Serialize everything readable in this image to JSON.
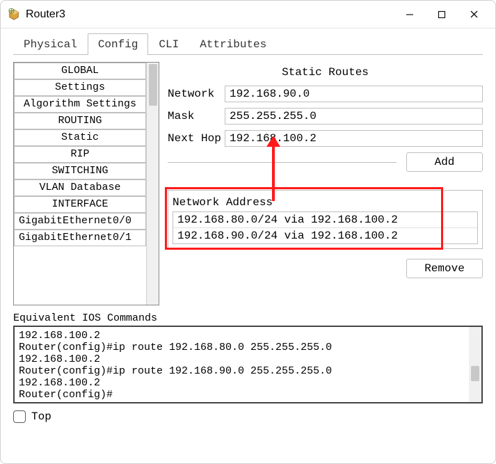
{
  "window": {
    "title": "Router3"
  },
  "tabs": [
    "Physical",
    "Config",
    "CLI",
    "Attributes"
  ],
  "active_tab_index": 1,
  "sidebar": {
    "items": [
      {
        "label": "GLOBAL",
        "align": "center"
      },
      {
        "label": "Settings",
        "align": "center"
      },
      {
        "label": "Algorithm Settings",
        "align": "center"
      },
      {
        "label": "ROUTING",
        "align": "center"
      },
      {
        "label": "Static",
        "align": "center"
      },
      {
        "label": "RIP",
        "align": "center"
      },
      {
        "label": "SWITCHING",
        "align": "center"
      },
      {
        "label": "VLAN Database",
        "align": "center"
      },
      {
        "label": "INTERFACE",
        "align": "center"
      },
      {
        "label": "GigabitEthernet0/0",
        "align": "left"
      },
      {
        "label": "GigabitEthernet0/1",
        "align": "left"
      }
    ]
  },
  "static_routes": {
    "title": "Static Routes",
    "network_label": "Network",
    "mask_label": "Mask",
    "nexthop_label": "Next Hop",
    "network_value": "192.168.90.0",
    "mask_value": "255.255.255.0",
    "nexthop_value": "192.168.100.2",
    "add_label": "Add",
    "list_header": "Network Address",
    "routes": [
      "192.168.80.0/24 via 192.168.100.2",
      "192.168.90.0/24 via 192.168.100.2"
    ],
    "remove_label": "Remove"
  },
  "ios": {
    "label": "Equivalent IOS Commands",
    "text": "192.168.100.2\nRouter(config)#ip route 192.168.80.0 255.255.255.0\n192.168.100.2\nRouter(config)#ip route 192.168.90.0 255.255.255.0\n192.168.100.2\nRouter(config)#"
  },
  "bottom": {
    "top_label": "Top"
  },
  "annotation": {
    "redbox_color": "#ff1a1a",
    "arrow_color": "#ff1a1a"
  }
}
